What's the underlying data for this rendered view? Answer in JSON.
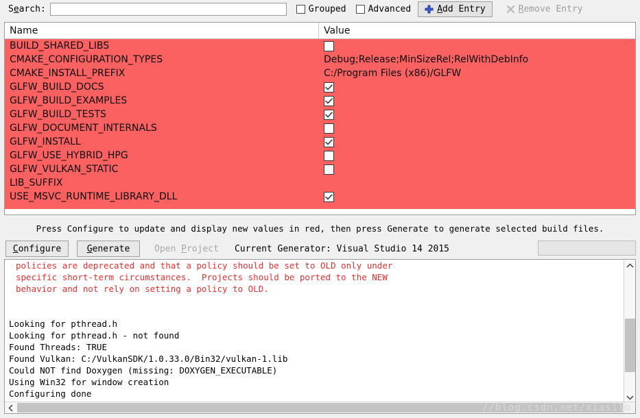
{
  "toolbar": {
    "search_label_prefix": "S",
    "search_label_accel": "e",
    "search_label_suffix": "arch:",
    "search_value": "",
    "search_placeholder": "",
    "grouped_label": "Grouped",
    "grouped_checked": false,
    "advanced_label": "Advanced",
    "advanced_checked": false,
    "add_entry_label": "Add Entry",
    "add_entry_accel": "A",
    "add_entry_icon": "plus-icon",
    "remove_entry_label": "Remove Entry",
    "remove_entry_accel": "R",
    "remove_entry_icon": "x-icon",
    "remove_entry_disabled": true
  },
  "table": {
    "columns": [
      "Name",
      "Value"
    ],
    "row_highlight_color": "#fc6161",
    "rows": [
      {
        "name": "BUILD_SHARED_LIBS",
        "type": "bool",
        "checked": false,
        "value": ""
      },
      {
        "name": "CMAKE_CONFIGURATION_TYPES",
        "type": "text",
        "checked": null,
        "value": "Debug;Release;MinSizeRel;RelWithDebInfo"
      },
      {
        "name": "CMAKE_INSTALL_PREFIX",
        "type": "text",
        "checked": null,
        "value": "C:/Program Files (x86)/GLFW"
      },
      {
        "name": "GLFW_BUILD_DOCS",
        "type": "bool",
        "checked": true,
        "value": ""
      },
      {
        "name": "GLFW_BUILD_EXAMPLES",
        "type": "bool",
        "checked": true,
        "value": ""
      },
      {
        "name": "GLFW_BUILD_TESTS",
        "type": "bool",
        "checked": true,
        "value": ""
      },
      {
        "name": "GLFW_DOCUMENT_INTERNALS",
        "type": "bool",
        "checked": false,
        "value": ""
      },
      {
        "name": "GLFW_INSTALL",
        "type": "bool",
        "checked": true,
        "value": ""
      },
      {
        "name": "GLFW_USE_HYBRID_HPG",
        "type": "bool",
        "checked": false,
        "value": ""
      },
      {
        "name": "GLFW_VULKAN_STATIC",
        "type": "bool",
        "checked": false,
        "value": ""
      },
      {
        "name": "LIB_SUFFIX",
        "type": "none",
        "checked": null,
        "value": ""
      },
      {
        "name": "USE_MSVC_RUNTIME_LIBRARY_DLL",
        "type": "bool",
        "checked": true,
        "value": ""
      }
    ]
  },
  "hint": {
    "text": "Press Configure to update and display new values in red, then press Generate to generate selected build files."
  },
  "actions": {
    "configure_label": "Configure",
    "configure_accel": "C",
    "generate_label": "Generate",
    "generate_accel": "G",
    "open_project_label": "Open Project",
    "open_project_accel": "P",
    "open_project_disabled": true,
    "generator_text": "Current Generator: Visual Studio 14 2015",
    "progress_value": ""
  },
  "log": {
    "lines": [
      {
        "text": "policies are deprecated and that a policy should be set to OLD only under",
        "color": "red",
        "clipped": true
      },
      {
        "text": "specific short-term circumstances.  Projects should be ported to the NEW",
        "color": "red"
      },
      {
        "text": "behavior and not rely on setting a policy to OLD.",
        "color": "red"
      },
      {
        "text": "",
        "color": "black"
      },
      {
        "text": "",
        "color": "black"
      },
      {
        "text": "Looking for pthread.h",
        "color": "black"
      },
      {
        "text": "Looking for pthread.h - not found",
        "color": "black"
      },
      {
        "text": "Found Threads: TRUE",
        "color": "black"
      },
      {
        "text": "Found Vulkan: C:/VulkanSDK/1.0.33.0/Bin32/vulkan-1.lib",
        "color": "black"
      },
      {
        "text": "Could NOT find Doxygen (missing: DOXYGEN_EXECUTABLE)",
        "color": "black"
      },
      {
        "text": "Using Win32 for window creation",
        "color": "black"
      },
      {
        "text": "Configuring done",
        "color": "black"
      }
    ]
  },
  "watermark": {
    "text": "//blog.csdn.net/xiasilo"
  }
}
